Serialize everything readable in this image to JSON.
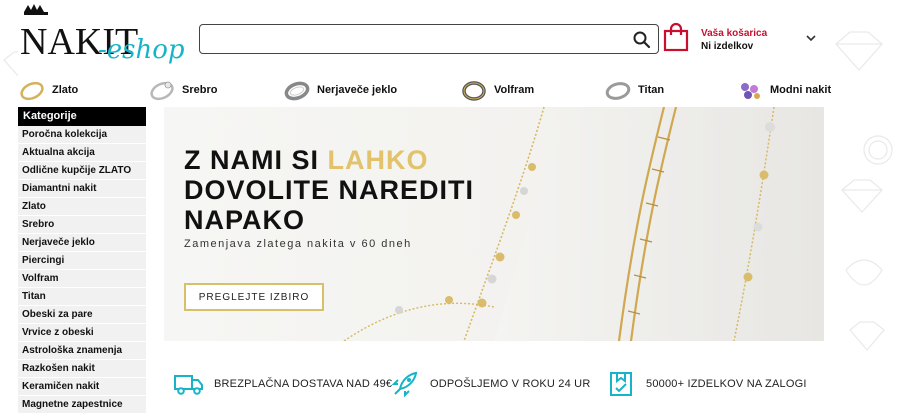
{
  "brand": {
    "logo_main": "NAKIT",
    "logo_script": "eshop",
    "accent": "#16b3c9",
    "red": "#c8102e",
    "gold": "#e2c36b"
  },
  "search": {
    "value": "",
    "placeholder": "",
    "icon": "search-icon"
  },
  "cart": {
    "title": "Vaša košarica",
    "status": "Ni izdelkov",
    "icon": "shopping-bag-icon"
  },
  "category_nav": [
    {
      "label": "Zlato",
      "icon": "gold-ring-icon"
    },
    {
      "label": "Srebro",
      "icon": "silver-ring-icon"
    },
    {
      "label": "Nerjaveče jeklo",
      "icon": "steel-ring-icon"
    },
    {
      "label": "Volfram",
      "icon": "tungsten-ring-icon"
    },
    {
      "label": "Titan",
      "icon": "titanium-ring-icon"
    },
    {
      "label": "Modni nakit",
      "icon": "fashion-jewelry-icon"
    }
  ],
  "sidebar": {
    "title": "Kategorije",
    "items": [
      "Poročna kolekcija",
      "Aktualna akcija",
      "Odlične kupčije ZLATO",
      "Diamantni nakit",
      "Zlato",
      "Srebro",
      "Nerjaveče jeklo",
      "Piercingi",
      "Volfram",
      "Titan",
      "Obeski za pare",
      "Vrvice z obeski",
      "Astrološka znamenja",
      "Razkošen nakit",
      "Keramičen nakit",
      "Magnetne zapestnice"
    ]
  },
  "hero": {
    "line1_a": "Z  NAMI SI ",
    "line1_b": "LAHKO",
    "line2": "DOVOLITE NAREDITI",
    "line3": "NAPAKO",
    "subtitle": "Zamenjava zlatega nakita v 60 dneh",
    "cta": "PREGLEJTE IZBIRO"
  },
  "features": [
    {
      "label": "BREZPLAČNA DOSTAVA NAD 49€",
      "icon": "truck-icon"
    },
    {
      "label": "ODPOŠLJEMO V ROKU 24 UR",
      "icon": "rocket-icon"
    },
    {
      "label": "50000+ IZDELKOV NA ZALOGI",
      "icon": "package-icon"
    }
  ]
}
